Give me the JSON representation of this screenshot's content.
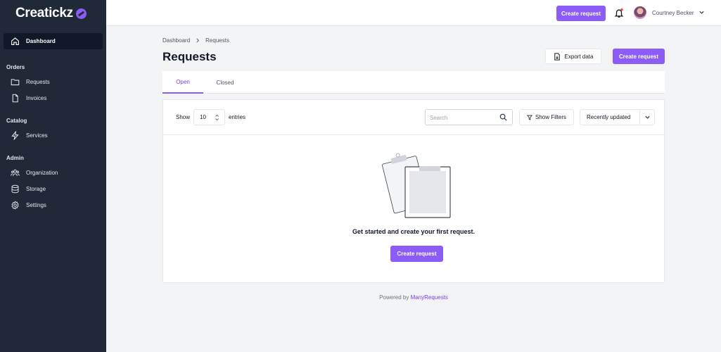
{
  "brand": {
    "name": "Creatickz",
    "accent": "#8b5cf6",
    "sidebar_bg": "#1f2937"
  },
  "sidebar": {
    "dashboard": {
      "label": "Dashboard",
      "icon": "home-icon"
    },
    "sections": [
      {
        "title": "Orders",
        "items": [
          {
            "label": "Requests",
            "icon": "folder-icon"
          },
          {
            "label": "Invoices",
            "icon": "document-icon"
          }
        ]
      },
      {
        "title": "Catalog",
        "items": [
          {
            "label": "Services",
            "icon": "bolt-icon"
          }
        ]
      },
      {
        "title": "Admin",
        "items": [
          {
            "label": "Organization",
            "icon": "users-icon"
          },
          {
            "label": "Storage",
            "icon": "database-icon"
          },
          {
            "label": "Settings",
            "icon": "gear-icon"
          }
        ]
      }
    ]
  },
  "topbar": {
    "create_label": "Create request",
    "user_name": "Courtney Becker"
  },
  "breadcrumb": [
    "Dashboard",
    "Requests"
  ],
  "page": {
    "title": "Requests",
    "export_label": "Export data",
    "create_label": "Create request"
  },
  "tabs": [
    "Open",
    "Closed"
  ],
  "active_tab": "Open",
  "toolbar": {
    "show_label": "Show",
    "entries_value": "10",
    "entries_label": "entries",
    "search_placeholder": "Search",
    "filters_label": "Show Filters",
    "sort_value": "Recently updated"
  },
  "empty_state": {
    "message": "Get started and create your first request.",
    "create_label": "Create request"
  },
  "footer": {
    "prefix": "Powered by",
    "link": "ManyRequests"
  }
}
